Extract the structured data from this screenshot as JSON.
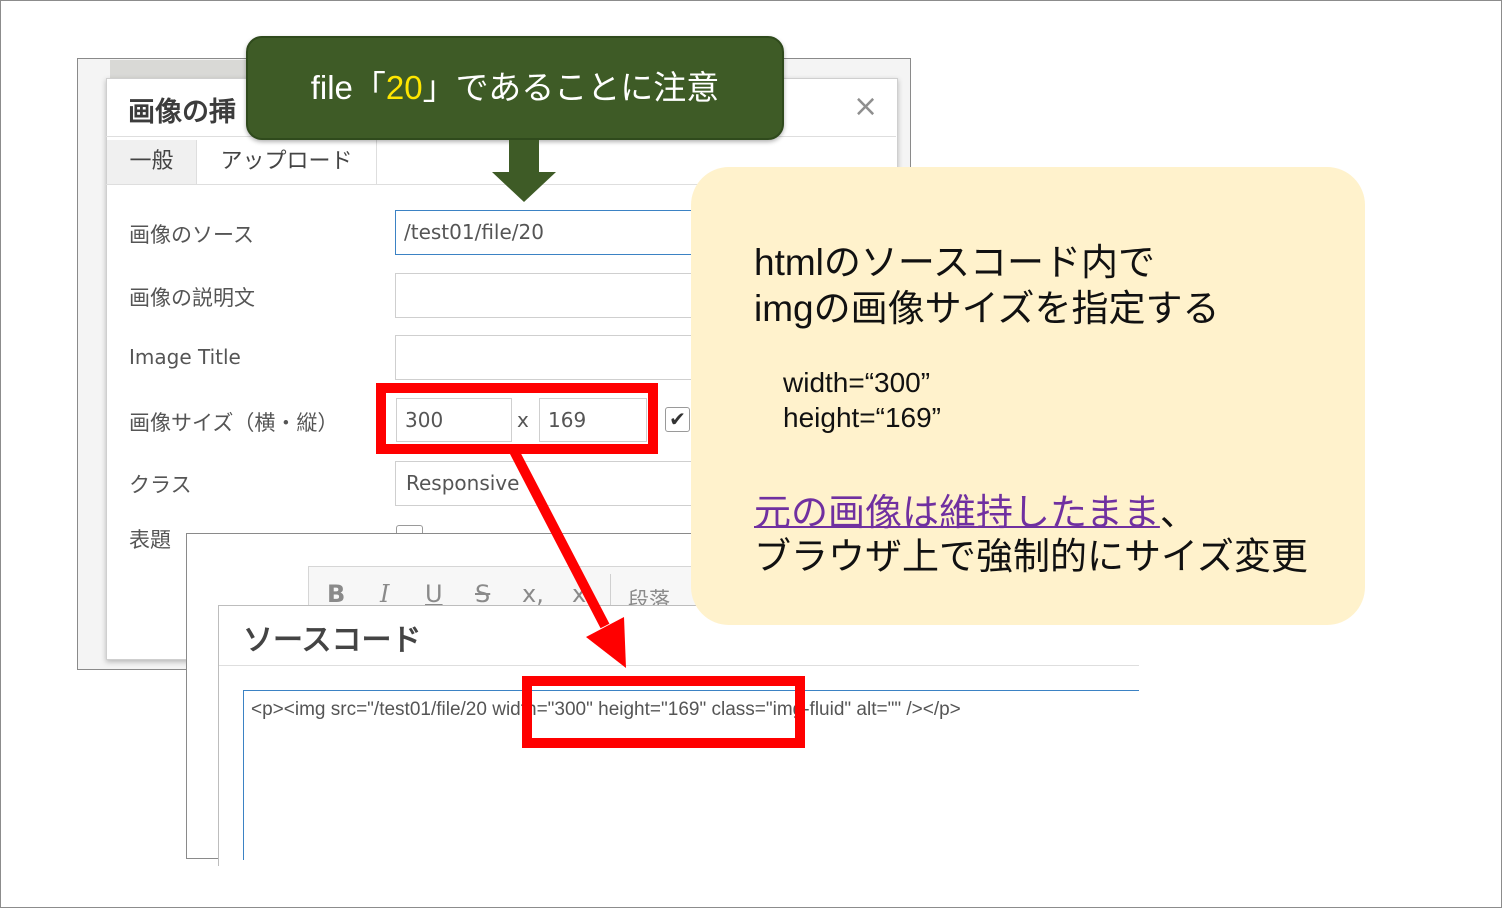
{
  "colors": {
    "annotation_red": "#ff0000",
    "note_green": "#3e5b26",
    "note_highlight": "#ffe600",
    "info_background": "#fff2cc",
    "link_purple": "#7030a0",
    "focus_blue": "#3b82c4"
  },
  "image_dialog": {
    "title": "画像の挿",
    "close_icon": "×",
    "tabs": [
      "一般",
      "アップロード"
    ],
    "fields": {
      "source_label": "画像のソース",
      "source_value": "/test01/file/20",
      "description_label": "画像の説明文",
      "image_title_label": "Image Title",
      "size_label": "画像サイズ（横・縦）",
      "width_value": "300",
      "size_separator": "x",
      "height_value": "169",
      "lock_ratio_checked": true,
      "class_label": "クラス",
      "class_value": "Responsive",
      "caption_label": "表題"
    }
  },
  "editor": {
    "toolbar": {
      "bold": "B",
      "italic": "I",
      "underline": "U",
      "strike": "S",
      "subscript": "x,",
      "superscript": "x",
      "format": "段落"
    }
  },
  "source_dialog": {
    "title": "ソースコード",
    "code_before": "<p><img src=\"/test01/file/20",
    "code_highlight": "width=\"300\" height=\"169\"",
    "code_after": " class=\"img-fluid\" alt=\"\" /></p>"
  },
  "note": {
    "prefix": "file「",
    "highlight": "20",
    "suffix": "」であることに注意"
  },
  "info": {
    "line1": "htmlのソースコード内で",
    "line2": "imgの画像サイズを指定する",
    "width_line": "width=“300”",
    "height_line": "height=“169”",
    "link_text": "元の画像は維持したまま",
    "link_suffix": "、",
    "line4": "ブラウザ上で強制的にサイズ変更"
  }
}
